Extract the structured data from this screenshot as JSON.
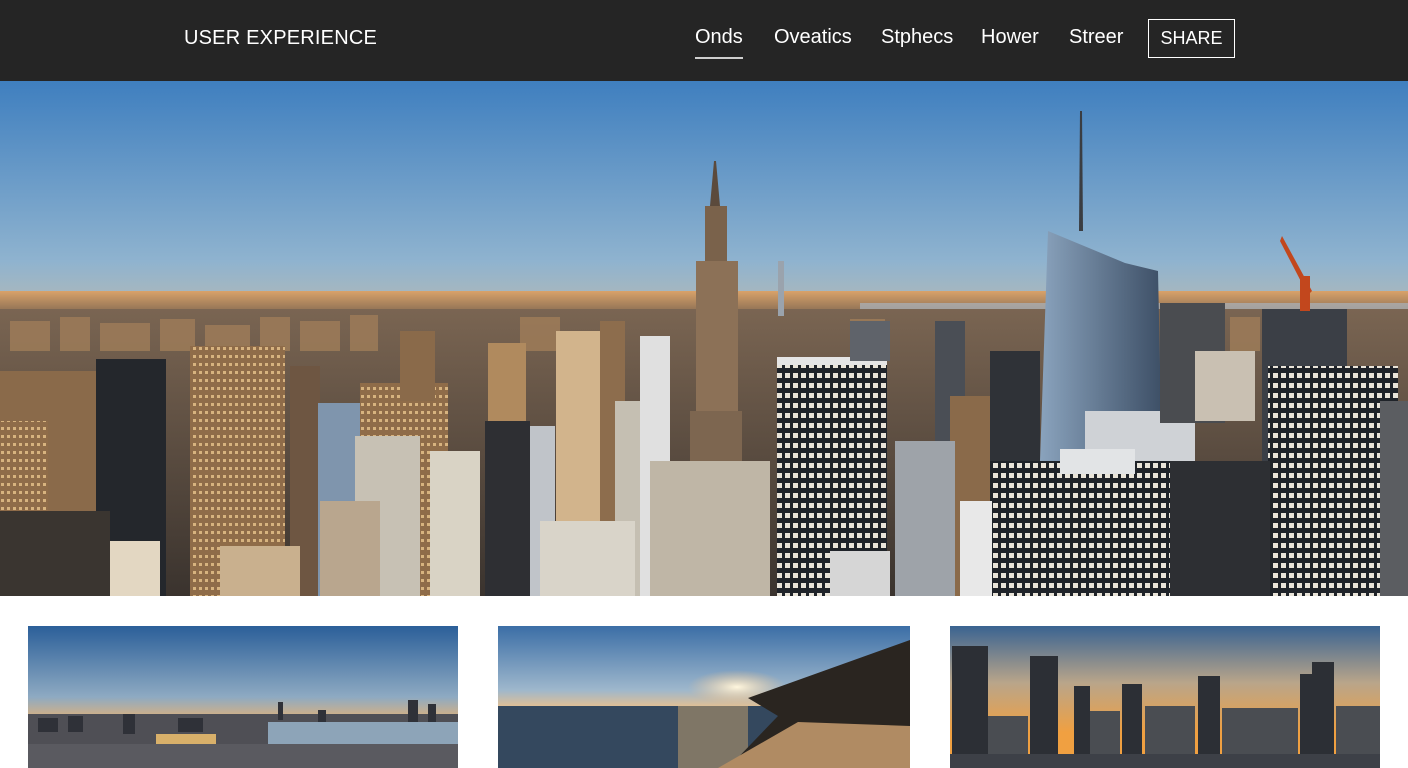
{
  "header": {
    "brand": "USER EXPERIENCE",
    "nav": [
      {
        "label": "Onds",
        "active": true
      },
      {
        "label": "Oveatics",
        "active": false
      },
      {
        "label": "Stphecs",
        "active": false
      },
      {
        "label": "Hower",
        "active": false
      },
      {
        "label": "Streer",
        "active": false
      }
    ],
    "share_label": "SHARE"
  },
  "colors": {
    "topbar": "#252525",
    "sky_top": "#3f7fbf",
    "sky_horizon": "#f3a14c",
    "building_dark": "#2a2d33",
    "building_warm": "#b08a5e"
  },
  "hero": {
    "description_icon": "city-skyline-image"
  },
  "cards": [
    {
      "icon": "city-river-sunset-image"
    },
    {
      "icon": "beach-sunset-image"
    },
    {
      "icon": "skyline-reflection-image"
    }
  ]
}
